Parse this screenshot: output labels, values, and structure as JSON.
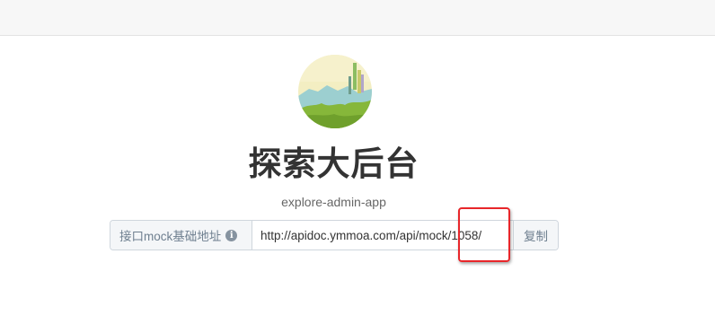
{
  "project": {
    "title": "探索大后台",
    "subtitle": "explore-admin-app"
  },
  "mock": {
    "label": "接口mock基础地址",
    "info_icon": "info-circle-icon",
    "url": "http://apidoc.ymmoa.com/api/mock/1058/",
    "copy_label": "复制"
  },
  "annotation": {
    "highlight_color": "#e8262a"
  }
}
